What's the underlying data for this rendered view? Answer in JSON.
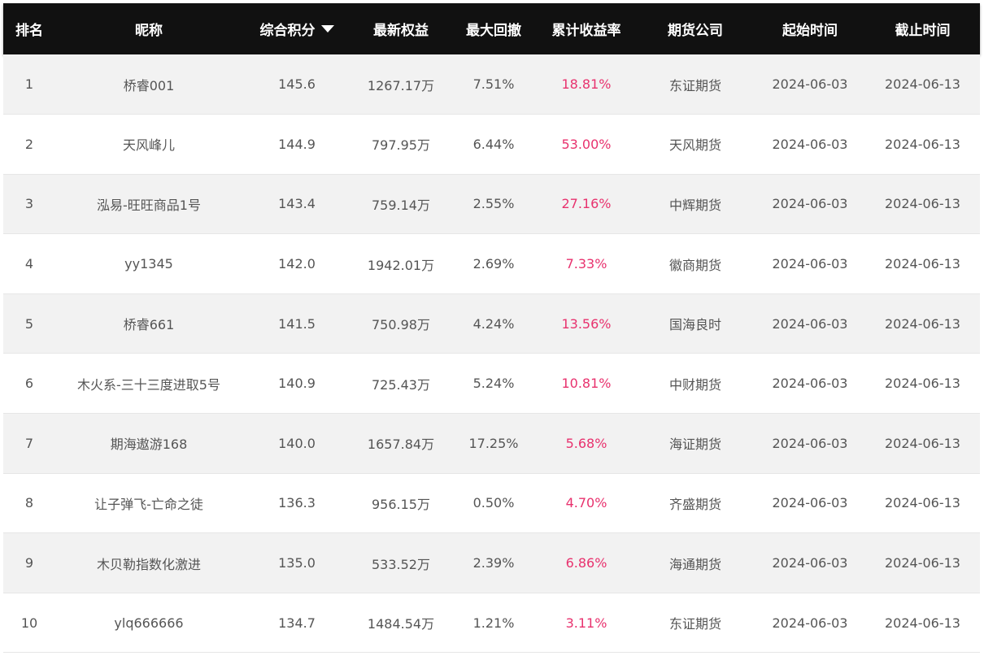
{
  "table": {
    "headers": [
      "排名",
      "昵称",
      "综合积分",
      "最新权益",
      "最大回撤",
      "累计收益率",
      "期货公司",
      "起始时间",
      "截止时间"
    ],
    "sorted_by": "综合积分",
    "sort_icon": "caret-down-icon",
    "colors": {
      "header_bg": "#111111",
      "row_alt_bg": "#f2f2f2",
      "return_text": "#e8326e"
    },
    "rows": [
      {
        "rank": "1",
        "nickname": "桥睿001",
        "score": "145.6",
        "equity": "1267.17万",
        "drawdown": "7.51%",
        "return": "18.81%",
        "company": "东证期货",
        "start": "2024-06-03",
        "end": "2024-06-13"
      },
      {
        "rank": "2",
        "nickname": "天风峰儿",
        "score": "144.9",
        "equity": "797.95万",
        "drawdown": "6.44%",
        "return": "53.00%",
        "company": "天风期货",
        "start": "2024-06-03",
        "end": "2024-06-13"
      },
      {
        "rank": "3",
        "nickname": "泓易-旺旺商品1号",
        "score": "143.4",
        "equity": "759.14万",
        "drawdown": "2.55%",
        "return": "27.16%",
        "company": "中辉期货",
        "start": "2024-06-03",
        "end": "2024-06-13"
      },
      {
        "rank": "4",
        "nickname": "yy1345",
        "score": "142.0",
        "equity": "1942.01万",
        "drawdown": "2.69%",
        "return": "7.33%",
        "company": "徽商期货",
        "start": "2024-06-03",
        "end": "2024-06-13"
      },
      {
        "rank": "5",
        "nickname": "桥睿661",
        "score": "141.5",
        "equity": "750.98万",
        "drawdown": "4.24%",
        "return": "13.56%",
        "company": "国海良时",
        "start": "2024-06-03",
        "end": "2024-06-13"
      },
      {
        "rank": "6",
        "nickname": "木火系-三十三度进取5号",
        "score": "140.9",
        "equity": "725.43万",
        "drawdown": "5.24%",
        "return": "10.81%",
        "company": "中财期货",
        "start": "2024-06-03",
        "end": "2024-06-13"
      },
      {
        "rank": "7",
        "nickname": "期海遨游168",
        "score": "140.0",
        "equity": "1657.84万",
        "drawdown": "17.25%",
        "return": "5.68%",
        "company": "海证期货",
        "start": "2024-06-03",
        "end": "2024-06-13"
      },
      {
        "rank": "8",
        "nickname": "让子弹飞-亡命之徒",
        "score": "136.3",
        "equity": "956.15万",
        "drawdown": "0.50%",
        "return": "4.70%",
        "company": "齐盛期货",
        "start": "2024-06-03",
        "end": "2024-06-13"
      },
      {
        "rank": "9",
        "nickname": "木贝勒指数化激进",
        "score": "135.0",
        "equity": "533.52万",
        "drawdown": "2.39%",
        "return": "6.86%",
        "company": "海通期货",
        "start": "2024-06-03",
        "end": "2024-06-13"
      },
      {
        "rank": "10",
        "nickname": "ylq666666",
        "score": "134.7",
        "equity": "1484.54万",
        "drawdown": "1.21%",
        "return": "3.11%",
        "company": "东证期货",
        "start": "2024-06-03",
        "end": "2024-06-13"
      }
    ]
  }
}
